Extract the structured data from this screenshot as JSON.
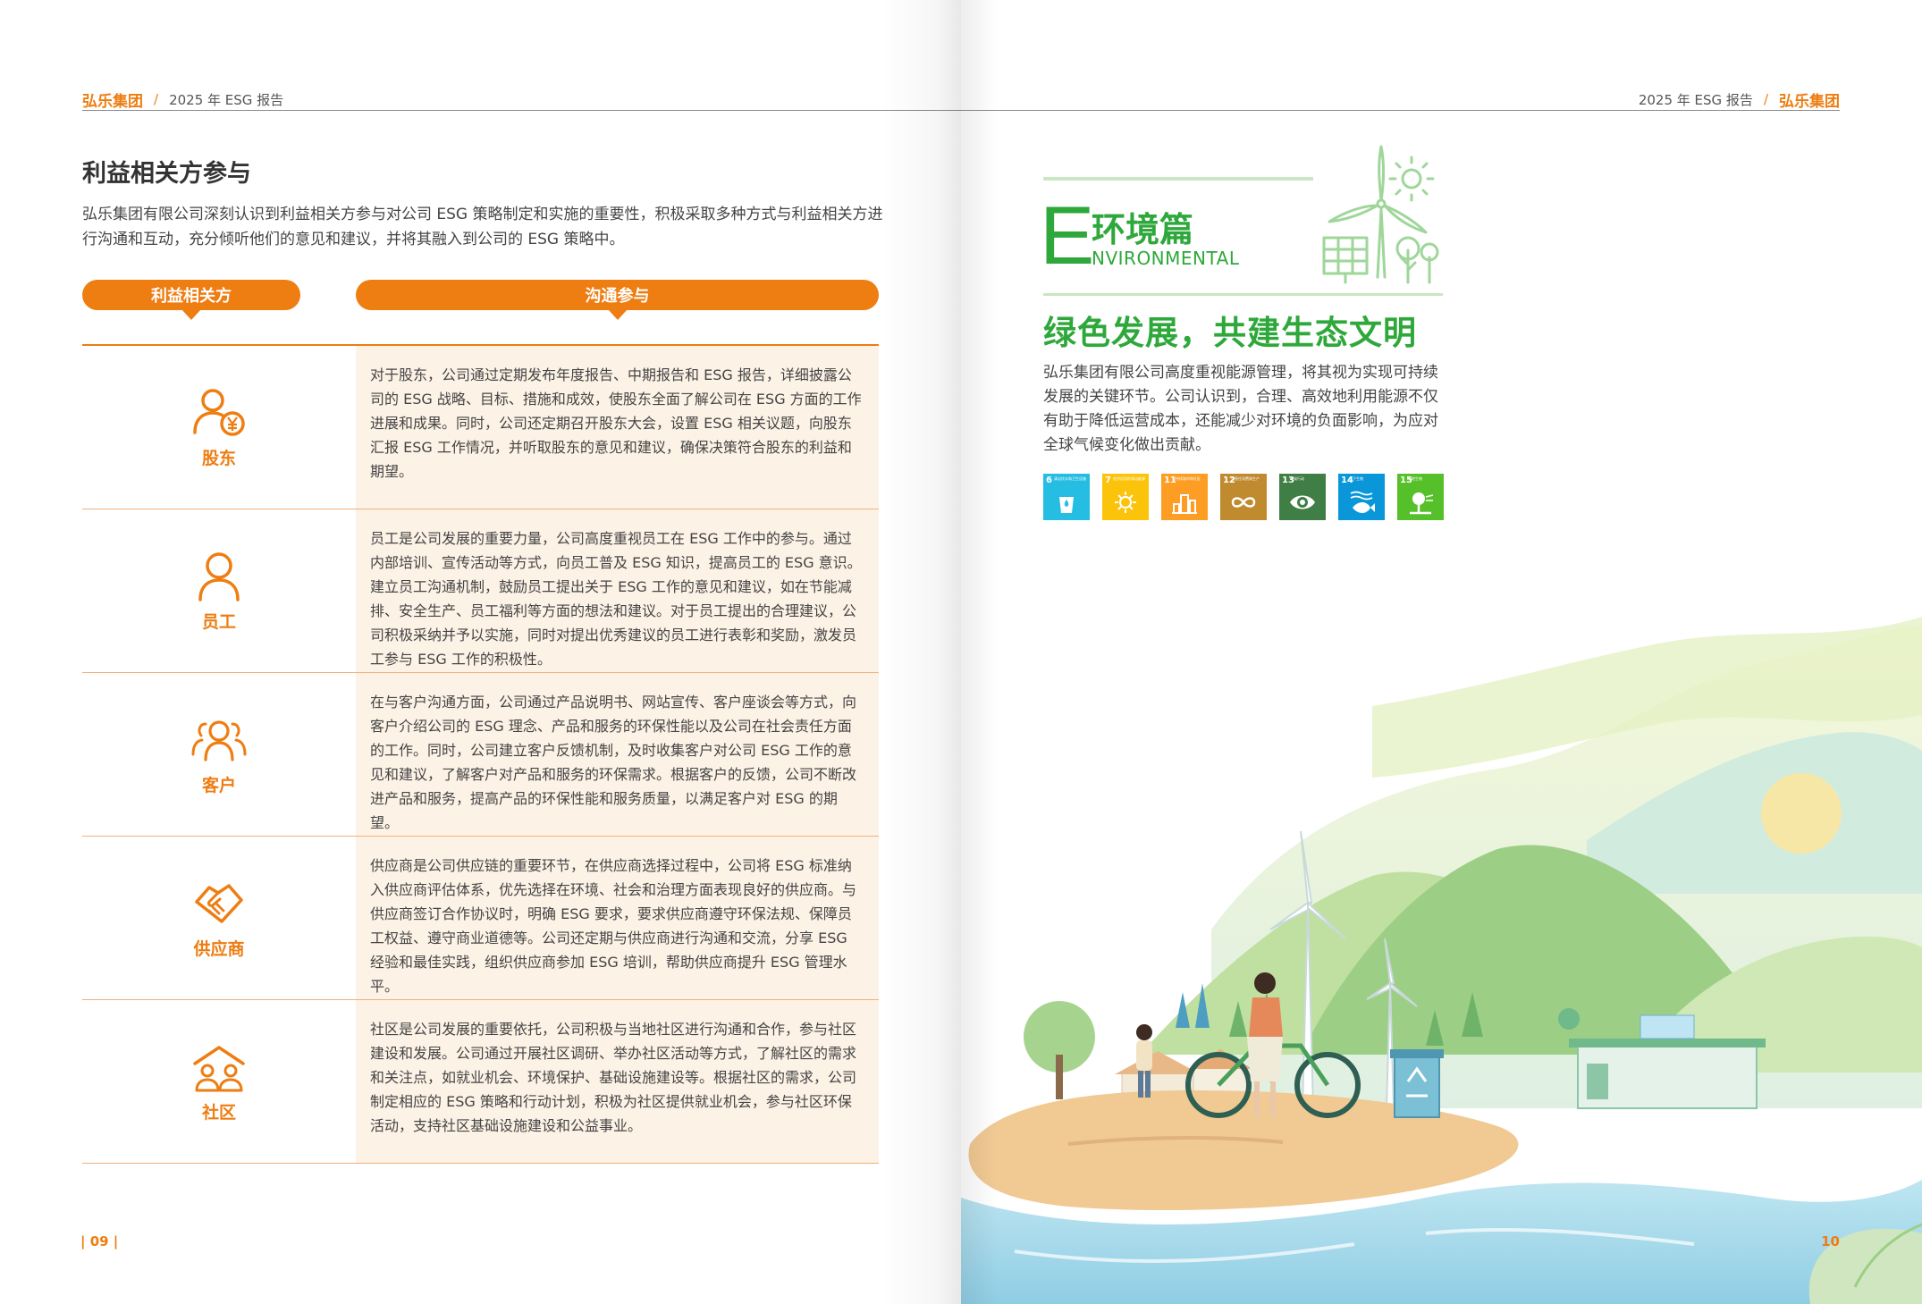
{
  "left": {
    "header": {
      "brand": "弘乐集团",
      "slash": "/",
      "report": "2025 年 ESG 报告"
    },
    "title": "利益相关方参与",
    "intro": "弘乐集团有限公司深刻认识到利益相关方参与对公司 ESG 策略制定和实施的重要性，积极采取多种方式与利益相关方进行沟通和互动，充分倾听他们的意见和建议，并将其融入到公司的 ESG 策略中。",
    "col_stakeholder": "利益相关方",
    "col_engagement": "沟通参与",
    "rows": [
      {
        "label": "股东",
        "icon": "shareholder-icon",
        "text": "对于股东，公司通过定期发布年度报告、中期报告和 ESG 报告，详细披露公司的 ESG 战略、目标、措施和成效，使股东全面了解公司在 ESG 方面的工作进展和成果。同时，公司还定期召开股东大会，设置 ESG 相关议题，向股东汇报 ESG 工作情况，并听取股东的意见和建议，确保决策符合股东的利益和期望。"
      },
      {
        "label": "员工",
        "icon": "employee-icon",
        "text": "员工是公司发展的重要力量，公司高度重视员工在 ESG 工作中的参与。通过内部培训、宣传活动等方式，向员工普及 ESG 知识，提高员工的 ESG 意识。建立员工沟通机制，鼓励员工提出关于 ESG 工作的意见和建议，如在节能减排、安全生产、员工福利等方面的想法和建议。对于员工提出的合理建议，公司积极采纳并予以实施，同时对提出优秀建议的员工进行表彰和奖励，激发员工参与 ESG 工作的积极性。"
      },
      {
        "label": "客户",
        "icon": "customer-icon",
        "text": "在与客户沟通方面，公司通过产品说明书、网站宣传、客户座谈会等方式，向客户介绍公司的 ESG 理念、产品和服务的环保性能以及公司在社会责任方面的工作。同时，公司建立客户反馈机制，及时收集客户对公司 ESG 工作的意见和建议，了解客户对产品和服务的环保需求。根据客户的反馈，公司不断改进产品和服务，提高产品的环保性能和服务质量，以满足客户对 ESG 的期望。"
      },
      {
        "label": "供应商",
        "icon": "handshake-icon",
        "text": "供应商是公司供应链的重要环节，在供应商选择过程中，公司将 ESG 标准纳入供应商评估体系，优先选择在环境、社会和治理方面表现良好的供应商。与供应商签订合作协议时，明确 ESG 要求，要求供应商遵守环保法规、保障员工权益、遵守商业道德等。公司还定期与供应商进行沟通和交流，分享 ESG 经验和最佳实践，组织供应商参加 ESG 培训，帮助供应商提升 ESG 管理水平。"
      },
      {
        "label": "社区",
        "icon": "community-icon",
        "text": "社区是公司发展的重要依托，公司积极与当地社区进行沟通和合作，参与社区建设和发展。公司通过开展社区调研、举办社区活动等方式，了解社区的需求和关注点，如就业机会、环境保护、基础设施建设等。根据社区的需求，公司制定相应的 ESG 策略和行动计划，积极为社区提供就业机会，参与社区环保活动，支持社区基础设施建设和公益事业。"
      }
    ],
    "page_number": "| 09 |"
  },
  "right": {
    "header": {
      "report": "2025 年 ESG 报告",
      "slash": "/",
      "brand": "弘乐集团"
    },
    "section_letter": "E",
    "section_cn": "环境篇",
    "section_en": "NVIRONMENTAL",
    "slogan": "绿色发展，共建生态文明",
    "text": "弘乐集团有限公司高度重视能源管理，将其视为实现可持续发展的关键环节。公司认识到，合理、高效地利用能源不仅有助于降低运营成本，还能减少对环境的负面影响，为应对全球气候变化做出贡献。",
    "sdgs": [
      {
        "num": "6",
        "caption": "清洁饮水和卫生设施",
        "color": "#26bde2",
        "icon": "water-drop-icon"
      },
      {
        "num": "7",
        "caption": "经济适用的清洁能源",
        "color": "#fcc30b",
        "icon": "sun-icon"
      },
      {
        "num": "11",
        "caption": "可持续城市和社区",
        "color": "#fd9d24",
        "icon": "city-icon"
      },
      {
        "num": "12",
        "caption": "负责任消费和生产",
        "color": "#bf8b2e",
        "icon": "infinity-icon"
      },
      {
        "num": "13",
        "caption": "气候行动",
        "color": "#3f7e44",
        "icon": "eye-globe-icon"
      },
      {
        "num": "14",
        "caption": "水下生物",
        "color": "#0a97d9",
        "icon": "fish-icon"
      },
      {
        "num": "15",
        "caption": "陆地生物",
        "color": "#56c02b",
        "icon": "tree-icon"
      }
    ],
    "page_number": "10"
  },
  "colors": {
    "orange": "#ee7d12",
    "green": "#2ea83b",
    "light_green": "#c8e7c2",
    "row_bg": "#fdf2e6"
  }
}
